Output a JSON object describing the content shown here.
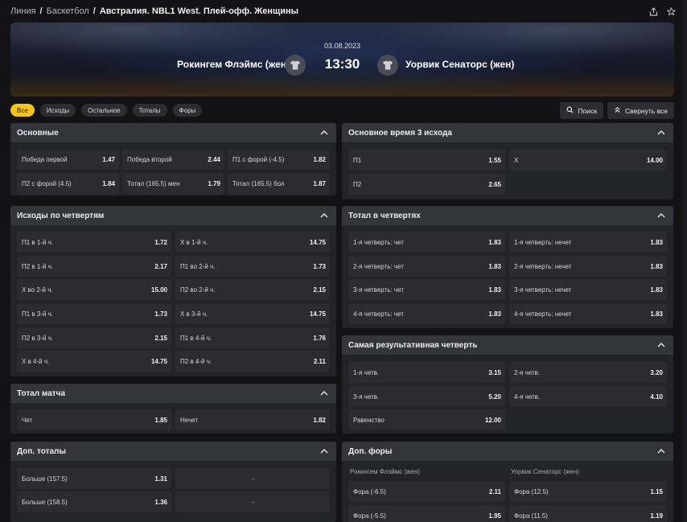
{
  "breadcrumb": {
    "items": [
      "Линия",
      "Баскетбол"
    ],
    "current": "Австралия. NBL1 West. Плей-офф. Женщины",
    "separator": "/"
  },
  "top_icons": [
    "share-icon",
    "star-icon"
  ],
  "match": {
    "date": "03.08.2023",
    "time": "13:30",
    "home": "Рокингем Флэймс (жен)",
    "away": "Уорвик Сенаторс (жен)"
  },
  "filters": [
    {
      "label": "Все",
      "active": true
    },
    {
      "label": "Исходы",
      "active": false
    },
    {
      "label": "Остальное",
      "active": false
    },
    {
      "label": "Тоталы",
      "active": false
    },
    {
      "label": "Форы",
      "active": false
    }
  ],
  "actions": {
    "search": "Поиск",
    "collapse": "Свернуть все"
  },
  "panels": {
    "main": {
      "title": "Основные",
      "cells": [
        [
          "Победа первой",
          "1.47"
        ],
        [
          "Победа второй",
          "2.44"
        ],
        [
          "П1 с форой (-4.5)",
          "1.82"
        ],
        [
          "П2 с форой (4.5)",
          "1.84"
        ],
        [
          "Тотал (165.5) мен",
          "1.79"
        ],
        [
          "Тотал (165.5) бол",
          "1.87"
        ]
      ]
    },
    "quarters": {
      "title": "Исходы по четвертям",
      "cells": [
        [
          "П1 в 1-й ч.",
          "1.72"
        ],
        [
          "Х в 1-й ч.",
          "14.75"
        ],
        [
          "П2 в 1-й ч.",
          "2.17"
        ],
        [
          "П1 во 2-й ч.",
          "1.73"
        ],
        [
          "Х во 2-й ч.",
          "15.00"
        ],
        [
          "П2 во 2-й ч.",
          "2.15"
        ],
        [
          "П1 в 3-й ч.",
          "1.73"
        ],
        [
          "Х в 3-й ч.",
          "14.75"
        ],
        [
          "П2 в 3-й ч.",
          "2.15"
        ],
        [
          "П1 в 4-й ч.",
          "1.76"
        ],
        [
          "Х в 4-й ч.",
          "14.75"
        ],
        [
          "П2 в 4-й ч.",
          "2.11"
        ]
      ]
    },
    "match_total": {
      "title": "Тотал матча",
      "cells": [
        [
          "Чет",
          "1.85"
        ],
        [
          "Нечет",
          "1.82"
        ]
      ]
    },
    "extra_totals": {
      "title": "Доп. тоталы",
      "cells": [
        [
          "Больше (157.5)",
          "1.31"
        ],
        [
          "",
          "–"
        ],
        [
          "Больше (158.5)",
          "1.36"
        ],
        [
          "",
          "–"
        ]
      ]
    },
    "regular_time": {
      "title": "Основное время 3 исхода",
      "cells": [
        [
          "П1",
          "1.55"
        ],
        [
          "Х",
          "14.00"
        ],
        [
          "П2",
          "2.65"
        ]
      ]
    },
    "quarter_totals": {
      "title": "Тотал в четвертях",
      "cells": [
        [
          "1-я четверть: чет",
          "1.83"
        ],
        [
          "1-я четверть: нечет",
          "1.83"
        ],
        [
          "2-я четверть: чет",
          "1.83"
        ],
        [
          "2-я четверть: нечет",
          "1.83"
        ],
        [
          "3-я четверть: чет",
          "1.83"
        ],
        [
          "3-я четверть: нечет",
          "1.83"
        ],
        [
          "4-я четверть: чет",
          "1.83"
        ],
        [
          "4-я четверть: нечет",
          "1.83"
        ]
      ]
    },
    "top_quarter": {
      "title": "Самая результативная четверть",
      "cells": [
        [
          "1-я четв.",
          "3.15"
        ],
        [
          "2-я четв.",
          "3.20"
        ],
        [
          "3-я четв.",
          "5.20"
        ],
        [
          "4-я четв.",
          "4.10"
        ],
        [
          "Равенство",
          "12.00"
        ]
      ]
    },
    "extra_handicaps": {
      "title": "Доп. форы",
      "home_label": "Рокингем Флэймс (жен)",
      "away_label": "Уорвик Сенаторс (жен)",
      "cells": [
        [
          "Фора (-6.5)",
          "2.11"
        ],
        [
          "Фора (12.5)",
          "1.15"
        ],
        [
          "Фора (-5.5)",
          "1.95"
        ],
        [
          "Фора (11.5)",
          "1.19"
        ]
      ]
    }
  }
}
